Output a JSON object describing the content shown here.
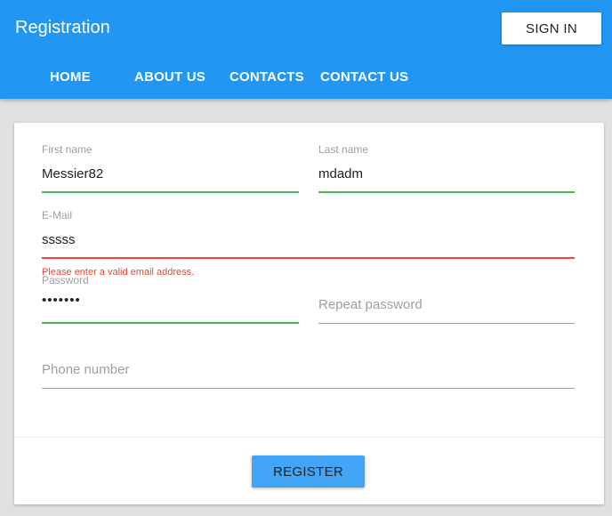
{
  "header": {
    "title": "Registration",
    "sign_in_label": "SIGN IN",
    "nav": [
      "HOME",
      "ABOUT US",
      "CONTACTS",
      "CONTACT US"
    ]
  },
  "form": {
    "first_name": {
      "label": "First name",
      "value": "Messier82",
      "state": "valid"
    },
    "last_name": {
      "label": "Last name",
      "value": "mdadm",
      "state": "valid"
    },
    "email": {
      "label": "E-Mail",
      "value": "sssss",
      "state": "invalid",
      "error": "Please enter a valid email address."
    },
    "password": {
      "label": "Password",
      "value": "•••••••",
      "state": "valid"
    },
    "repeat_password": {
      "placeholder": "Repeat password",
      "value": ""
    },
    "phone": {
      "placeholder": "Phone number",
      "value": ""
    },
    "register_label": "REGISTER"
  },
  "colors": {
    "primary": "#2196f3",
    "valid": "#4caf50",
    "error": "#f44336",
    "button": "#42a5f5"
  }
}
